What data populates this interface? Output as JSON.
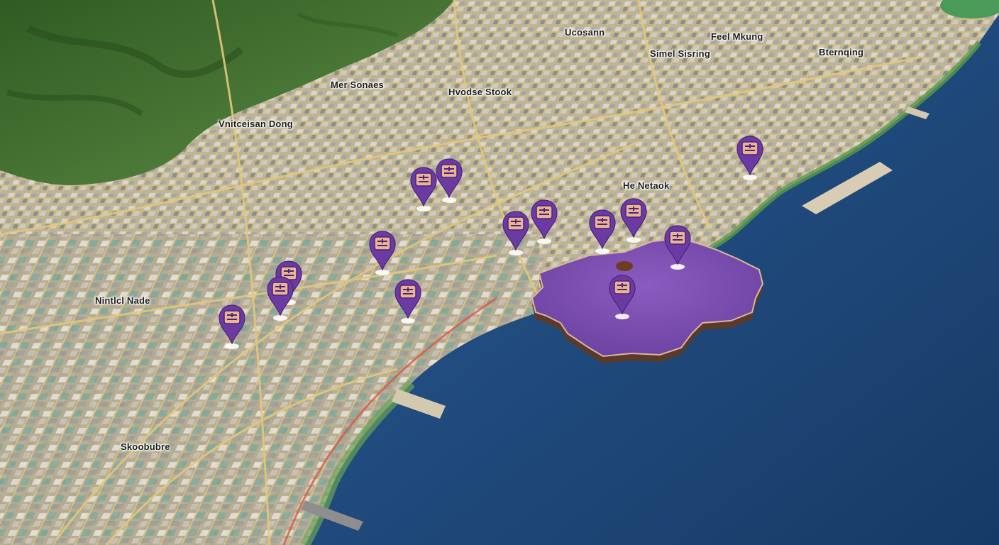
{
  "map": {
    "style": "3d-aerial-city",
    "colors": {
      "sea": "#1f4a7e",
      "sea_deep": "#163a66",
      "forest": "#3f6f2f",
      "land": "#b9ab8c",
      "highlight_region": "#7a4fb0",
      "marker": "#6b3aa2",
      "marker_glyph": "#e8b494"
    },
    "labels": [
      {
        "id": "ugoasann",
        "text": "Uᴄosann"
      },
      {
        "id": "feel-mkung",
        "text": "Feel Mkung"
      },
      {
        "id": "simel-sisring",
        "text": "Simel Sisring"
      },
      {
        "id": "bternoqing",
        "text": "Bternqing"
      },
      {
        "id": "mer-sonaes",
        "text": "Mer Sonaes"
      },
      {
        "id": "hvodse-stook",
        "text": "Hvodse Stook"
      },
      {
        "id": "vnitceisan-dong",
        "text": "Vnitceisan Dong"
      },
      {
        "id": "he-netaok",
        "text": "He Netaok"
      },
      {
        "id": "ninticl-nade",
        "text": "Nintlcl Nade"
      },
      {
        "id": "skoobubre",
        "text": "Skoobubre"
      }
    ],
    "markers": [
      {
        "id": "m1",
        "icon": "sim-card-icon"
      },
      {
        "id": "m2",
        "icon": "sim-card-icon"
      },
      {
        "id": "m3",
        "icon": "sim-card-icon"
      },
      {
        "id": "m4",
        "icon": "sim-card-icon"
      },
      {
        "id": "m5",
        "icon": "sim-card-icon"
      },
      {
        "id": "m6",
        "icon": "sim-card-icon"
      },
      {
        "id": "m7",
        "icon": "sim-card-icon"
      },
      {
        "id": "m8",
        "icon": "sim-card-icon"
      },
      {
        "id": "m9",
        "icon": "sim-card-icon"
      },
      {
        "id": "m10",
        "icon": "sim-card-icon"
      },
      {
        "id": "m11",
        "icon": "sim-card-icon"
      },
      {
        "id": "m12",
        "icon": "sim-card-icon"
      },
      {
        "id": "m13",
        "icon": "sim-card-icon"
      },
      {
        "id": "m14",
        "icon": "sim-card-icon"
      },
      {
        "id": "m15",
        "icon": "sim-card-icon"
      }
    ]
  }
}
